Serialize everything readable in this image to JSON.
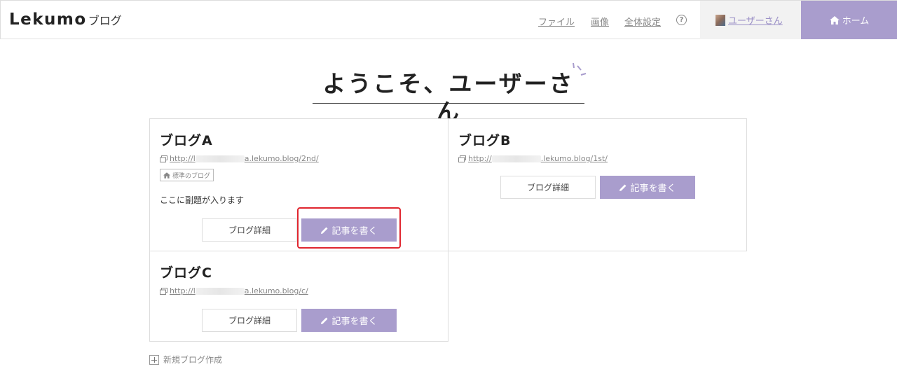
{
  "header": {
    "logo_main": "Lekumo",
    "logo_sub": "ブログ",
    "nav": [
      {
        "label": "ファイル"
      },
      {
        "label": "画像"
      },
      {
        "label": "全体設定"
      }
    ],
    "help_icon_label": "?",
    "user_name": "ユーザーさん",
    "home_label": "ホーム"
  },
  "welcome": "ようこそ、ユーザーさん",
  "blogs": [
    {
      "title": "ブログA",
      "url_prefix": "http://l",
      "url_suffix": "a.lekumo.blog/2nd/",
      "badge": "標準のブログ",
      "subtitle": "ここに副題が入ります",
      "detail_label": "ブログ詳細",
      "write_label": "記事を書く"
    },
    {
      "title": "ブログB",
      "url_prefix": "http://",
      "url_suffix": ".lekumo.blog/1st/",
      "detail_label": "ブログ詳細",
      "write_label": "記事を書く"
    },
    {
      "title": "ブログC",
      "url_prefix": "http://l",
      "url_suffix": "a.lekumo.blog/c/",
      "detail_label": "ブログ詳細",
      "write_label": "記事を書く"
    }
  ],
  "new_blog_label": "新規ブログ作成",
  "colors": {
    "accent": "#a99dcd",
    "highlight": "#e0262f"
  }
}
